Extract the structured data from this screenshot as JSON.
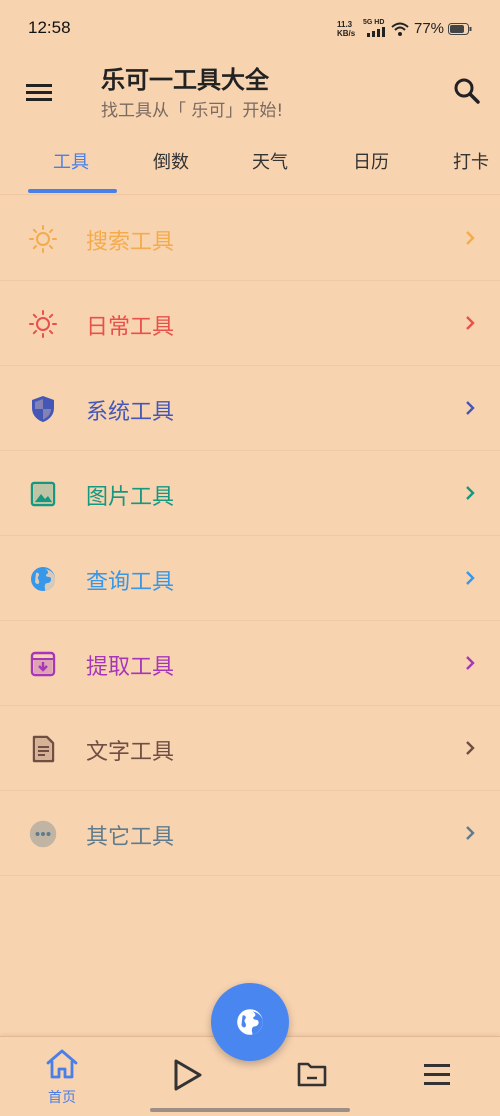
{
  "status_bar": {
    "time": "12:58",
    "net_speed_value": "11.3",
    "net_speed_unit": "KB/s",
    "signal_label": "5G HD",
    "battery": "77%"
  },
  "app_bar": {
    "title": "乐可一工具大全",
    "subtitle": "找工具从「 乐可」开始!"
  },
  "tabs": [
    {
      "label": "工具",
      "active": true
    },
    {
      "label": "倒数",
      "active": false
    },
    {
      "label": "天气",
      "active": false
    },
    {
      "label": "日历",
      "active": false
    },
    {
      "label": "打卡",
      "active": false
    }
  ],
  "tools": [
    {
      "label": "搜索工具",
      "icon": "sun-icon",
      "color": "#f4ab4c"
    },
    {
      "label": "日常工具",
      "icon": "sun-icon",
      "color": "#e8504a"
    },
    {
      "label": "系统工具",
      "icon": "shield-icon",
      "color": "#4557b6"
    },
    {
      "label": "图片工具",
      "icon": "image-icon",
      "color": "#16977f"
    },
    {
      "label": "查询工具",
      "icon": "globe-icon",
      "color": "#3797e8"
    },
    {
      "label": "提取工具",
      "icon": "archive-icon",
      "color": "#a637b8"
    },
    {
      "label": "文字工具",
      "icon": "document-icon",
      "color": "#6f4e43"
    },
    {
      "label": "其它工具",
      "icon": "more-icon",
      "color": "#607b8b"
    }
  ],
  "fab": {
    "icon": "globe-icon",
    "color": "#4a86f0"
  },
  "bottom_nav": [
    {
      "label": "首页",
      "icon": "home-icon",
      "active": true
    },
    {
      "label": "",
      "icon": "play-icon",
      "active": false
    },
    {
      "label": "",
      "icon": "folder-icon",
      "active": false
    },
    {
      "label": "",
      "icon": "menu-icon",
      "active": false
    }
  ],
  "colors": {
    "background": "#f7d3b0",
    "accent": "#4a7fe8"
  }
}
